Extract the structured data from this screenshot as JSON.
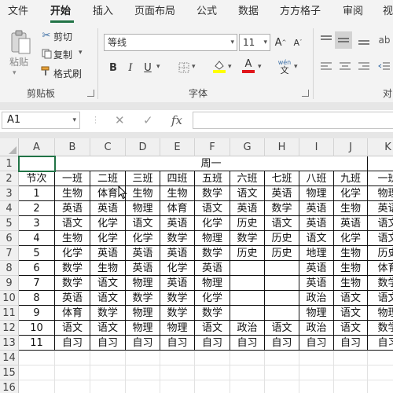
{
  "tabs": [
    "文件",
    "开始",
    "插入",
    "页面布局",
    "公式",
    "数据",
    "方方格子",
    "审阅",
    "视"
  ],
  "clipboard": {
    "paste": "粘贴",
    "cut": "剪切",
    "copy": "复制",
    "format_painter": "格式刷",
    "group": "剪贴板"
  },
  "font": {
    "name": "等线",
    "size": "11",
    "bold": "B",
    "italic": "I",
    "underline": "U",
    "font_color_letter": "A",
    "wen": "wén",
    "wen_char": "文",
    "group": "字体"
  },
  "align": {
    "group": "对"
  },
  "formula": {
    "name_box": "A1",
    "cancel": "✕",
    "enter": "✓",
    "fx": "fx",
    "value": ""
  },
  "sheet": {
    "columns": [
      "A",
      "B",
      "C",
      "D",
      "E",
      "F",
      "G",
      "H",
      "I",
      "J",
      "K"
    ],
    "rows": [
      "1",
      "2",
      "3",
      "4",
      "5",
      "6",
      "7",
      "8",
      "9",
      "10",
      "11",
      "12",
      "13",
      "14",
      "15",
      "16"
    ],
    "title": "周一",
    "header": [
      "节次",
      "一班",
      "二班",
      "三班",
      "四班",
      "五班",
      "六班",
      "七班",
      "八班",
      "九班",
      "一班"
    ],
    "data": [
      [
        "1",
        "生物",
        "体育",
        "生物",
        "生物",
        "数学",
        "语文",
        "英语",
        "物理",
        "化学",
        "物理"
      ],
      [
        "2",
        "英语",
        "英语",
        "物理",
        "体育",
        "语文",
        "英语",
        "数学",
        "英语",
        "生物",
        "英语"
      ],
      [
        "3",
        "语文",
        "化学",
        "语文",
        "英语",
        "化学",
        "历史",
        "语文",
        "英语",
        "英语",
        "语文"
      ],
      [
        "4",
        "生物",
        "化学",
        "化学",
        "数学",
        "物理",
        "数学",
        "历史",
        "语文",
        "化学",
        "语文"
      ],
      [
        "5",
        "化学",
        "英语",
        "英语",
        "英语",
        "数学",
        "历史",
        "历史",
        "地理",
        "生物",
        "历史"
      ],
      [
        "6",
        "数学",
        "生物",
        "英语",
        "化学",
        "英语",
        "",
        "",
        "英语",
        "生物",
        "体育"
      ],
      [
        "7",
        "数学",
        "语文",
        "物理",
        "英语",
        "物理",
        "",
        "",
        "英语",
        "生物",
        "数学"
      ],
      [
        "8",
        "英语",
        "语文",
        "数学",
        "数学",
        "化学",
        "",
        "",
        "政治",
        "语文",
        "语文"
      ],
      [
        "9",
        "体育",
        "数学",
        "物理",
        "数学",
        "数学",
        "",
        "",
        "物理",
        "语文",
        "物理"
      ],
      [
        "10",
        "语文",
        "语文",
        "物理",
        "物理",
        "语文",
        "政治",
        "语文",
        "政治",
        "语文",
        "数学"
      ],
      [
        "11",
        "自习",
        "自习",
        "自习",
        "自习",
        "自习",
        "自习",
        "自习",
        "自习",
        "自习",
        "自习"
      ]
    ]
  },
  "colors": {
    "accent": "#217346",
    "header_bg": "#f0f0f0"
  }
}
